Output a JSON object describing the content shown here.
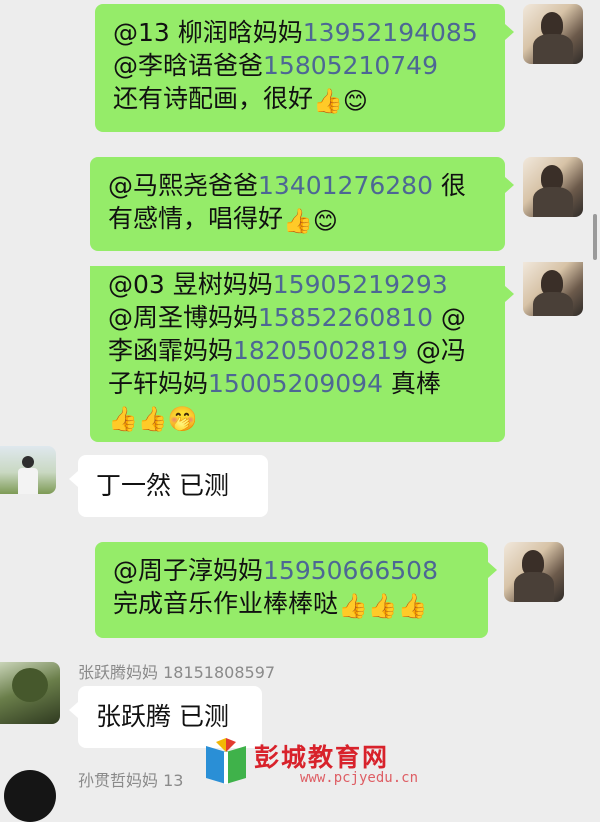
{
  "messages": [
    {
      "side": "right",
      "lines": [
        {
          "mention": "@13 柳润晗妈妈",
          "phone": "13952194085"
        },
        {
          "mention": " @李晗语爸爸",
          "phone": "15805210749"
        },
        {
          "text": "还有诗配画，很好"
        }
      ],
      "emojis": [
        "👍",
        "😊"
      ]
    },
    {
      "side": "right",
      "lines": [
        {
          "mention": "@马熙尧爸爸",
          "phone": "13401276280",
          "after": " 很"
        },
        {
          "text": "有感情，唱得好"
        }
      ],
      "emojis": [
        "👍",
        "😊"
      ]
    },
    {
      "side": "right",
      "lines": [
        {
          "mention": "@03 昱树妈妈",
          "phone": "15905219293"
        },
        {
          "mention": "@周圣博妈妈",
          "phone": "15852260810",
          "after": " @"
        },
        {
          "mention": "李函霏妈妈",
          "phone": "18205002819",
          "after": " @冯"
        },
        {
          "mention": "子轩妈妈",
          "phone": "15005209094",
          "after": " 真棒"
        }
      ],
      "emojis": [
        "👍",
        "👍",
        "🤭"
      ]
    },
    {
      "side": "left",
      "sender": "",
      "text": "丁一然  已测"
    },
    {
      "side": "right",
      "lines": [
        {
          "mention": "@周子淳妈妈",
          "phone": "15950666508"
        },
        {
          "text": "完成音乐作业棒棒哒"
        }
      ],
      "emojis": [
        "👍",
        "👍",
        "👍"
      ]
    },
    {
      "side": "left",
      "sender": "张跃腾妈妈 18151808597",
      "text": "张跃腾  已测"
    },
    {
      "side": "left",
      "sender": "孙贯哲妈妈 13",
      "text": ""
    }
  ],
  "watermark": {
    "title": "彭城教育网",
    "url": "www.pcjyedu.cn"
  },
  "icons": {
    "self_avatar": "avatar-photo-icon",
    "thumbs_up": "thumbs-up-emoji",
    "smile": "smile-emoji",
    "cover_mouth": "hand-over-mouth-emoji"
  }
}
